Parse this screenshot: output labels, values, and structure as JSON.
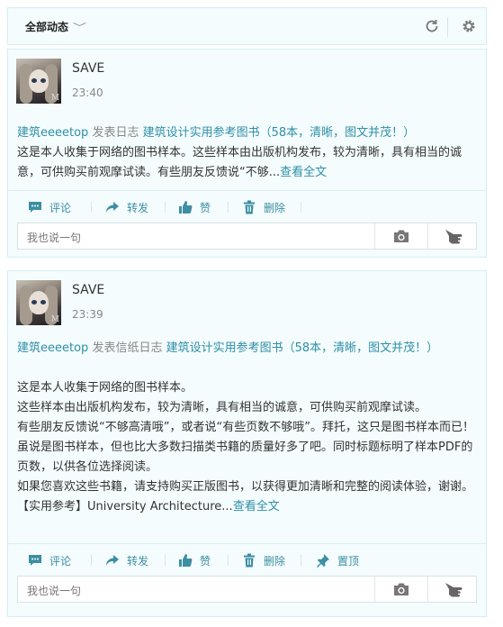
{
  "topbar": {
    "filter_label": "全部动态",
    "filter_chevron": "﹀",
    "icons": [
      "refresh-icon",
      "gear-icon"
    ]
  },
  "posts": [
    {
      "user": "SAVE",
      "time": "23:40",
      "author_link": "建筑eeeetop",
      "action": "发表日志",
      "title_link": "建筑设计实用参考图书（58本，清晰，图文并茂！）",
      "excerpt": "这是本人收集于网络的图书样本。这些样本由出版机构发布，较为清晰，具有相当的诚意，可供购买前观摩试读。有些朋友反馈说“不够...",
      "more": "查看全文",
      "actions": [
        "评论",
        "转发",
        "赞",
        "删除"
      ],
      "reply_placeholder": "我也说一句"
    },
    {
      "user": "SAVE",
      "time": "23:39",
      "author_link": "建筑eeeetop",
      "action": "发表信纸日志",
      "title_link": "建筑设计实用参考图书（58本，清晰，图文并茂！）",
      "paragraphs": [
        "这是本人收集于网络的图书样本。",
        "这些样本由出版机构发布，较为清晰，具有相当的诚意，可供购买前观摩试读。",
        "有些朋友反馈说“不够高清哦”，或者说“有些页数不够哦”。拜托，这只是图书样本而已！虽说是图书样本，但也比大多数扫描类书籍的质量好多了吧。同时标题标明了样本PDF的页数，以供各位选择阅读。",
        "如果您喜欢这些书籍，请支持购买正版图书，以获得更加清晰和完整的阅读体验，谢谢。",
        "【实用参考】University Architecture..."
      ],
      "more": "查看全文",
      "actions": [
        "评论",
        "转发",
        "赞",
        "删除",
        "置顶"
      ],
      "reply_placeholder": "我也说一句"
    }
  ],
  "colors": {
    "accent": "#2e8fa8",
    "card_bg": "#f4fcfd",
    "border": "#d4eef2"
  }
}
